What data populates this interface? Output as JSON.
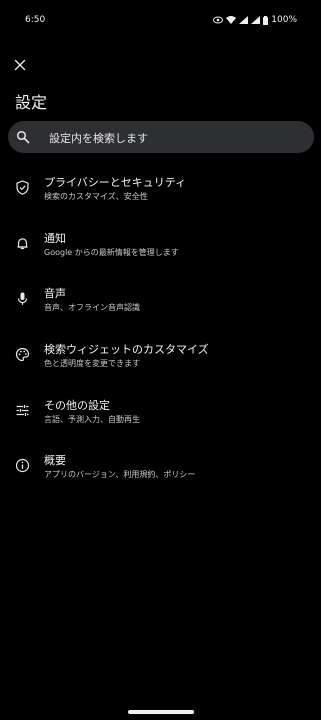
{
  "status": {
    "time": "6:50",
    "battery": "100%"
  },
  "header": {
    "title": "設定"
  },
  "search": {
    "placeholder": "設定内を検索します"
  },
  "items": [
    {
      "label": "プライバシーとセキュリティ",
      "sub": "検索のカスタマイズ、安全性"
    },
    {
      "label": "通知",
      "sub": "Google からの最新情報を管理します"
    },
    {
      "label": "音声",
      "sub": "音声、オフライン音声認識"
    },
    {
      "label": "検索ウィジェットのカスタマイズ",
      "sub": "色と透明度を変更できます"
    },
    {
      "label": "その他の設定",
      "sub": "言語、予測入力、自動再生"
    },
    {
      "label": "概要",
      "sub": "アプリのバージョン、利用規約、ポリシー"
    }
  ]
}
